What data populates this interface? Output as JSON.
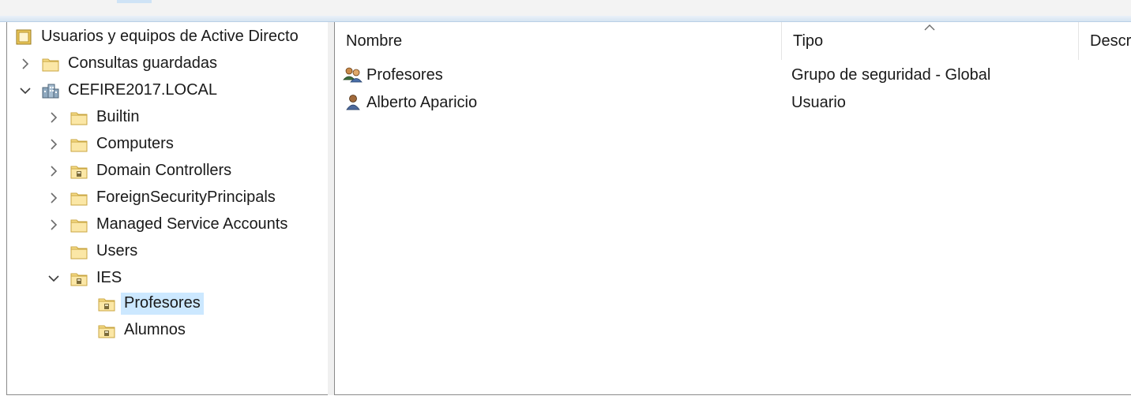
{
  "tree": {
    "root_label": "Usuarios y equipos de Active Directo",
    "items": [
      {
        "label": "Consultas guardadas",
        "icon": "folder-icon"
      },
      {
        "label": "CEFIRE2017.LOCAL",
        "icon": "domain-icon"
      },
      {
        "label": "Builtin",
        "icon": "folder-icon"
      },
      {
        "label": "Computers",
        "icon": "folder-icon"
      },
      {
        "label": "Domain Controllers",
        "icon": "ou-folder-icon"
      },
      {
        "label": "ForeignSecurityPrincipals",
        "icon": "folder-icon"
      },
      {
        "label": "Managed Service Accounts",
        "icon": "folder-icon"
      },
      {
        "label": "Users",
        "icon": "folder-icon"
      },
      {
        "label": "IES",
        "icon": "ou-folder-icon"
      },
      {
        "label": "Profesores",
        "icon": "ou-folder-icon",
        "selected": true
      },
      {
        "label": "Alumnos",
        "icon": "ou-folder-icon"
      }
    ]
  },
  "list": {
    "columns": [
      "Nombre",
      "Tipo",
      "Descr"
    ],
    "rows": [
      {
        "name": "Profesores",
        "type": "Grupo de seguridad - Global",
        "icon": "group-icon"
      },
      {
        "name": "Alberto Aparicio",
        "type": "Usuario",
        "icon": "user-icon"
      }
    ]
  },
  "colors": {
    "selection": "#cce8ff",
    "folder": "#f5d77a"
  }
}
